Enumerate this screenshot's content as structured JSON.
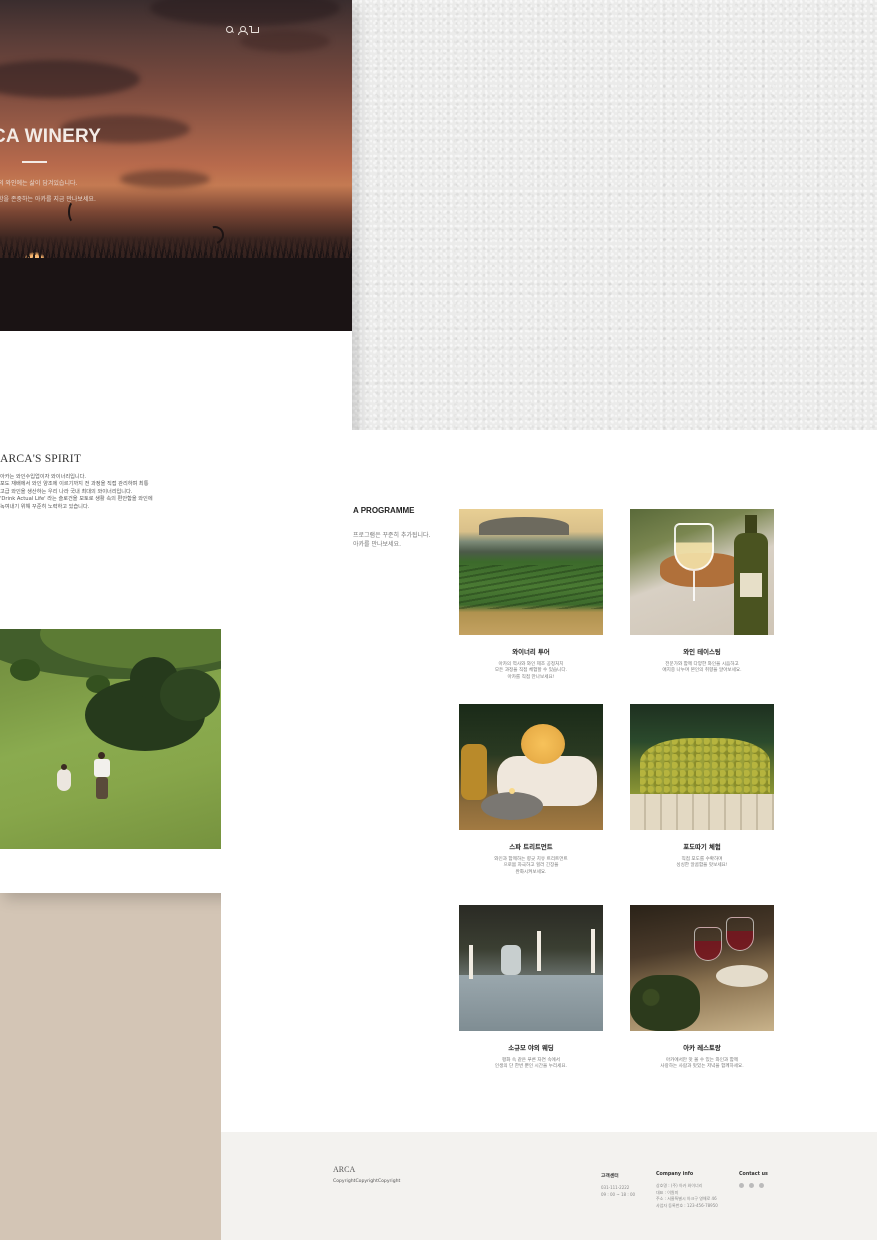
{
  "hero": {
    "title": "CA WINERY",
    "subtitle_lines": [
      "의 와인에는 삶이 담겨있습니다.",
      "함을 존중하는 아카를 지금 만나보세요."
    ]
  },
  "spirit": {
    "title": "ARCA'S SPIRIT",
    "lines": [
      "아카는 와인수입업이자 와이너리입니다.",
      "포도 재배에서 와인 양조에 이르기까지 전 과정을 직접 관리하며 최통",
      "고급 와인을 생산하는 우리 나라 국내 최대의 와이너리입니다.",
      "'Drink Actual Life' 라는 슬로건을 모토로 생활 속의 편안함을 와인에",
      "녹여내기 위해 꾸준히 노력하고 있습니다."
    ]
  },
  "programme": {
    "title": "A PROGRAMME",
    "desc_lines": [
      "프로그램은 꾸준히 추가됩니다.",
      "아카를 만나보세요."
    ],
    "cards": [
      {
        "name": "와이너리 투어",
        "desc": [
          "아카의 역사와 와인 제조 공정처치",
          "모든 과정을 직접 체험할 수 있습니다.",
          "아카를 직접 만나보세요!"
        ]
      },
      {
        "name": "와인 테이스팅",
        "desc": [
          "전문가와 함께 다양한 와인을 시음하고",
          "애지중 나누며 본인의 취향을 알아보세요."
        ]
      },
      {
        "name": "스파 트리트먼트",
        "desc": [
          "와인과 함께하는 향긋 치유 트리트먼트",
          "으로몸 자극하고 힐러 긴장을",
          "완화시켜보세요."
        ]
      },
      {
        "name": "포도따기 체험",
        "desc": [
          "직접 포도를 수확하며",
          "싱싱한 알콤함을 맛보세요!"
        ]
      },
      {
        "name": "소규모 야외 웨딩",
        "desc": [
          "평화 속 같은 푸른 자연 속에서",
          "인생의 단 한번 뿐인 시간을 누리세요."
        ]
      },
      {
        "name": "아카 레스토랑",
        "desc": [
          "아카에서만 맛 볼 수 있는 와인과 함께",
          "사랑하는 사람과 맛있는 저녁을 함께하세요."
        ]
      }
    ]
  },
  "footer": {
    "logo": "ARCA",
    "copyright": "CopyrightCopyrightCopyright",
    "cs_center": {
      "heading": "고객센터",
      "lines": [
        "031-111-2222",
        "09 : 00 ~ 18 : 00"
      ]
    },
    "company_info": {
      "heading": "Company info",
      "lines": [
        "상호명 : (주) 아카 와이너리",
        "대표 : 이원미",
        "주소 : 서울특별시 아크구 영해로 46",
        "사업자 등록번호 : 123-456-78950"
      ]
    },
    "contact": {
      "heading": "Contact us",
      "icons": [
        "social-icon-1",
        "social-icon-2",
        "social-icon-3"
      ]
    }
  },
  "colors": {
    "beige_panel": "#d3c5b5",
    "footer_bg": "#f3f2ef",
    "paper_bg": "#ebebea"
  }
}
